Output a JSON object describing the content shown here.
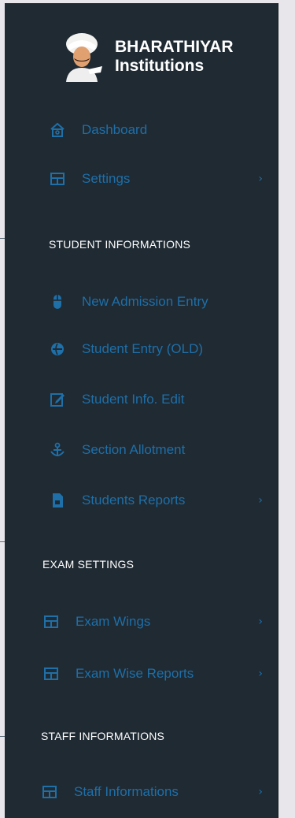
{
  "brand": {
    "name": "BHARATHIYAR",
    "subtitle": "Institutions"
  },
  "colors": {
    "sidebar_bg": "#1f2a33",
    "accent": "#1f6fa8",
    "section_text": "#ffffff"
  },
  "nav": {
    "top": [
      {
        "label": "Dashboard",
        "icon": "home-icon",
        "has_chevron": false
      },
      {
        "label": "Settings",
        "icon": "table-icon",
        "has_chevron": true,
        "chevron": "›"
      }
    ],
    "student": {
      "heading": "STUDENT INFORMATIONS",
      "items": [
        {
          "label": "New Admission Entry",
          "icon": "mouse-icon"
        },
        {
          "label": "Student Entry (OLD)",
          "icon": "globe-icon"
        },
        {
          "label": "Student Info. Edit",
          "icon": "edit-icon"
        },
        {
          "label": "Section Allotment",
          "icon": "anchor-icon"
        },
        {
          "label": "Students Reports",
          "icon": "file-icon",
          "chevron": "›"
        }
      ]
    },
    "exam": {
      "heading": "EXAM SETTINGS",
      "items": [
        {
          "label": "Exam Wings",
          "icon": "table-icon",
          "chevron": "›"
        },
        {
          "label": "Exam Wise Reports",
          "icon": "table-icon",
          "chevron": "›"
        }
      ]
    },
    "staff": {
      "heading": "STAFF INFORMATIONS",
      "items": [
        {
          "label": "Staff Informations",
          "icon": "table-icon",
          "chevron": "›"
        }
      ]
    }
  }
}
